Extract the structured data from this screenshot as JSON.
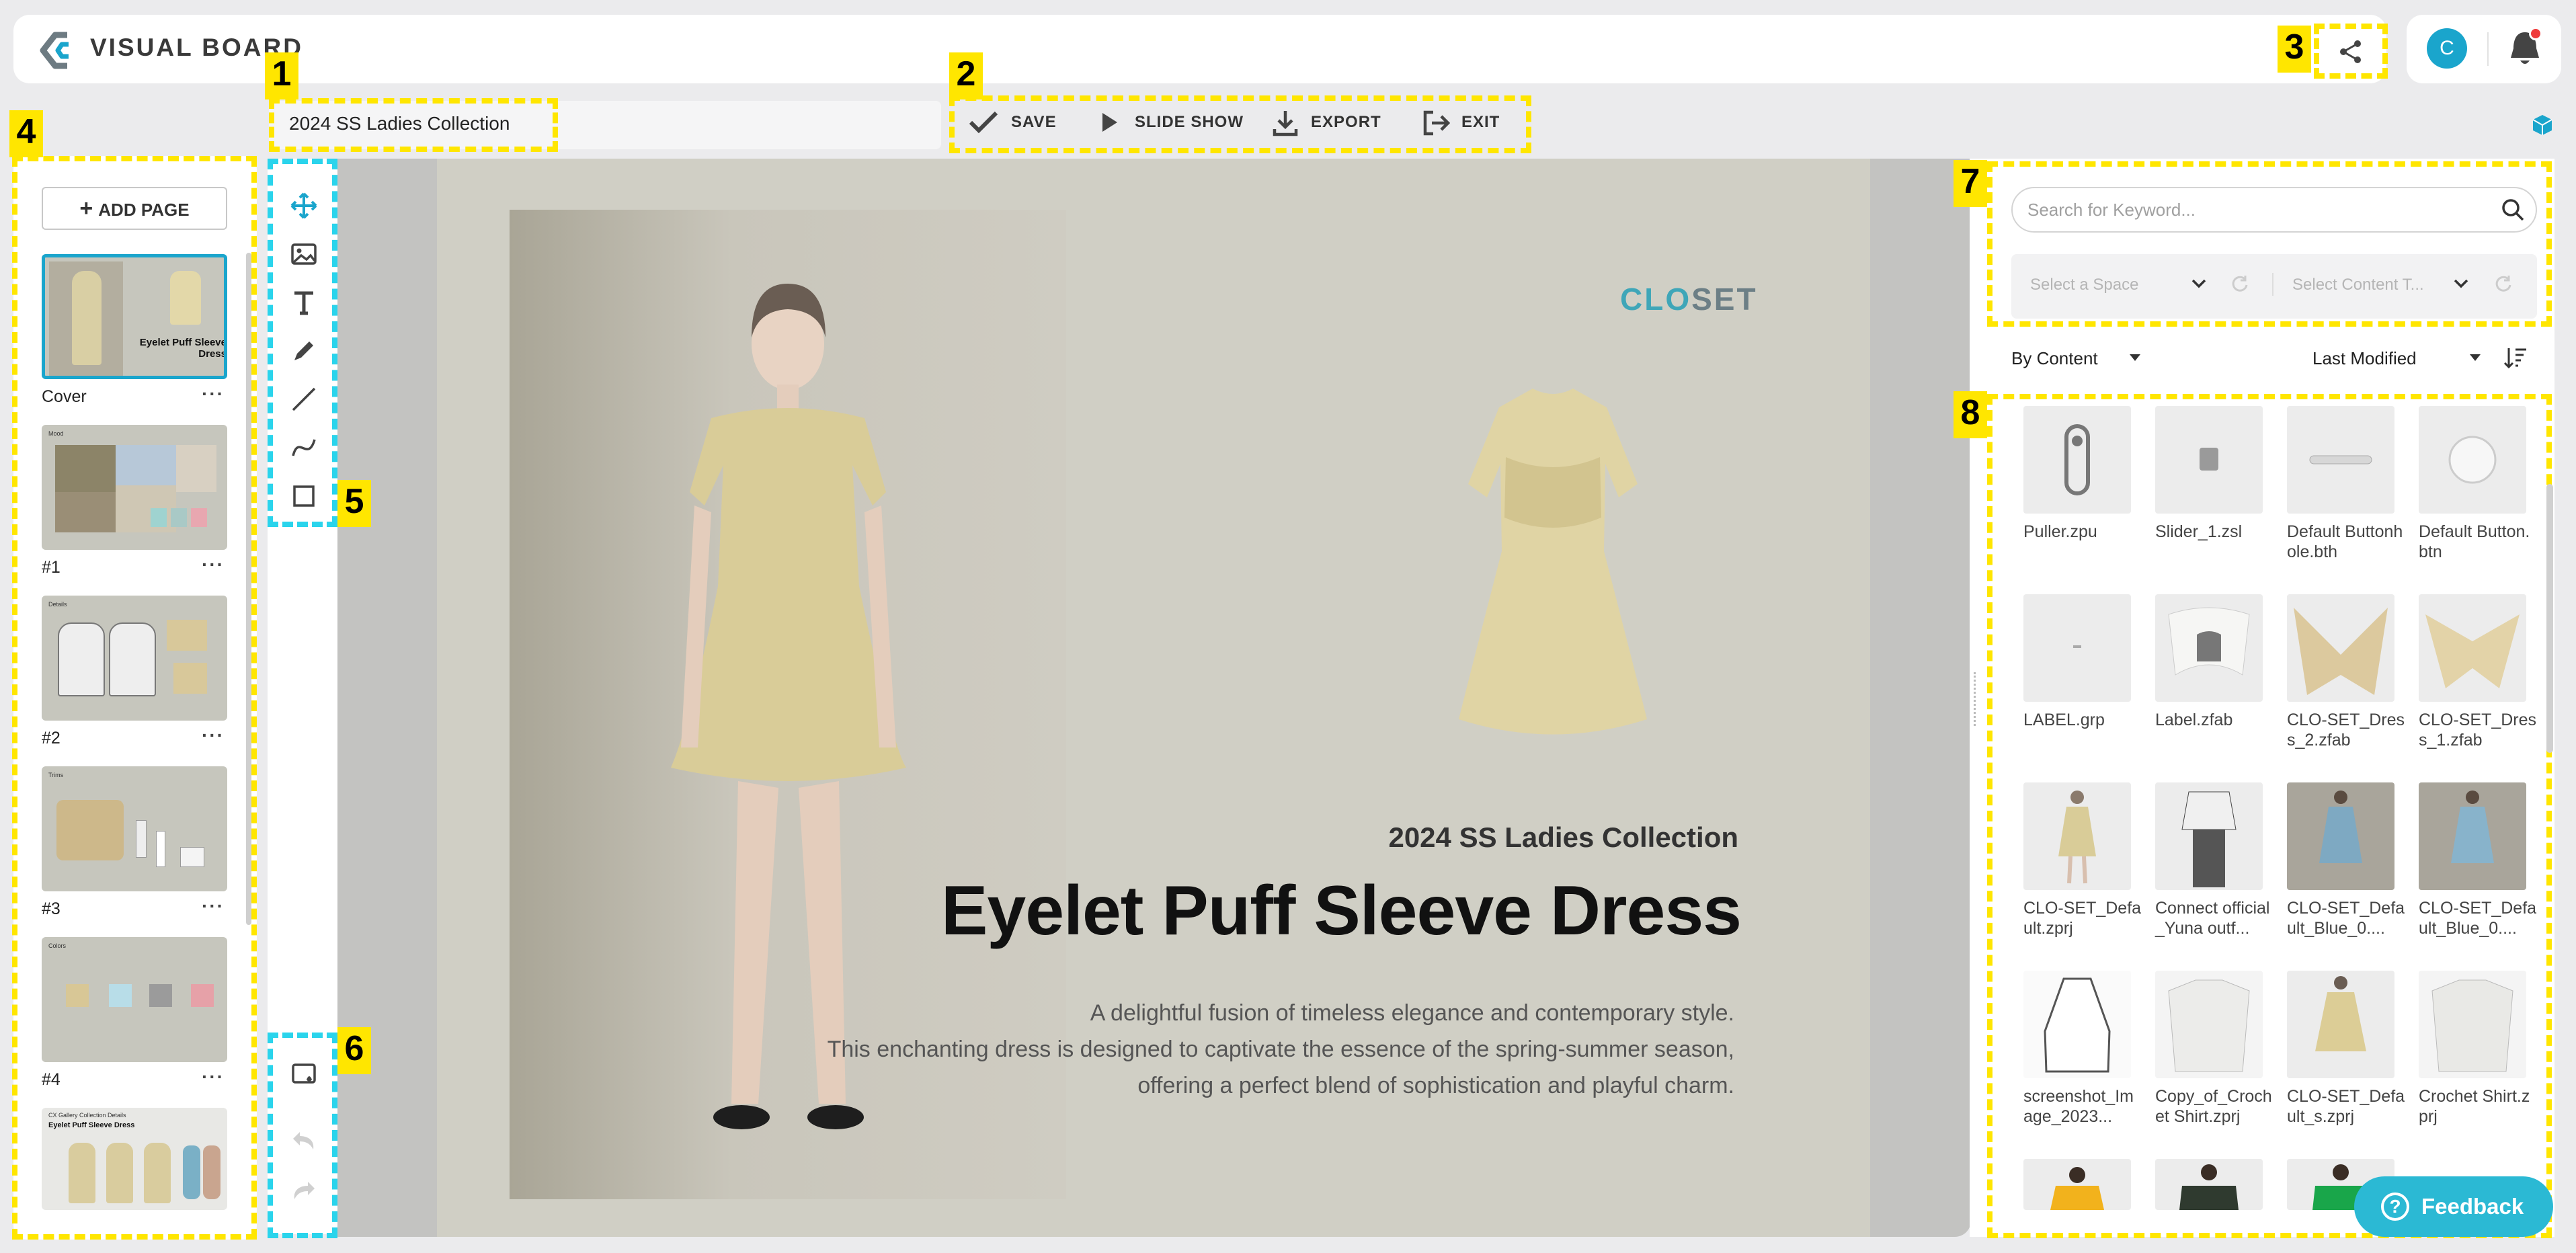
{
  "app": {
    "brand": "VISUAL BOARD"
  },
  "header": {
    "avatar_initial": "C",
    "share_label": "share-icon",
    "notification_badge": true
  },
  "callouts": [
    "1",
    "2",
    "3",
    "4",
    "5",
    "6",
    "7",
    "8"
  ],
  "board": {
    "title": "2024 SS Ladies Collection"
  },
  "actions": {
    "save": "SAVE",
    "slideshow": "SLIDE SHOW",
    "export": "EXPORT",
    "exit": "EXIT"
  },
  "pages": {
    "add_label": "ADD PAGE",
    "more": "···",
    "items": [
      {
        "label": "Cover"
      },
      {
        "label": "#1"
      },
      {
        "label": "#2"
      },
      {
        "label": "#3"
      },
      {
        "label": "#4"
      }
    ],
    "thumb_text": {
      "cover_title": "Eyelet Puff Sleeve Dress",
      "p1": "Mood",
      "p2": "Details",
      "p3": "Trims",
      "p4": "Colors",
      "p5_sub": "CX Gallery Collection Details",
      "p5_title": "Eyelet Puff Sleeve Dress"
    }
  },
  "tools": [
    "move-icon",
    "image-icon",
    "text-icon",
    "pen-icon",
    "line-icon",
    "curve-icon",
    "rectangle-icon"
  ],
  "bottom_tools": [
    "background-icon",
    "undo-icon",
    "redo-icon"
  ],
  "slide": {
    "logo_a": "CLO",
    "logo_b": "SET",
    "subtitle": "2024 SS Ladies Collection",
    "title": "Eyelet Puff Sleeve Dress",
    "desc1": "A delightful fusion of timeless elegance and contemporary style.",
    "desc2": "This enchanting dress is designed to captivate the essence of the spring-summer season,",
    "desc3": "offering a perfect blend of sophistication and playful charm."
  },
  "library": {
    "search_placeholder": "Search for Keyword...",
    "space_placeholder": "Select a Space",
    "content_placeholder": "Select Content T...",
    "group_by": "By Content",
    "sort_by": "Last Modified",
    "items": [
      "Puller.zpu",
      "Slider_1.zsl",
      "Default Buttonhole.bth",
      "Default Button.btn",
      "LABEL.grp",
      "Label.zfab",
      "CLO-SET_Dress_2.zfab",
      "CLO-SET_Dress_1.zfab",
      "CLO-SET_Default.zprj",
      "Connect official_Yuna outf...",
      "CLO-SET_Default_Blue_0....",
      "CLO-SET_Default_Blue_0....",
      "screenshot_Image_2023...",
      "Copy_of_Crochet Shirt.zprj",
      "CLO-SET_Default_s.zprj",
      "Crochet Shirt.zprj"
    ]
  },
  "feedback": {
    "label": "Feedback",
    "icon": "?"
  },
  "colors": {
    "accent": "#1aa5cc",
    "highlight": "#ffe600",
    "tool_box": "#2ad4ec"
  }
}
